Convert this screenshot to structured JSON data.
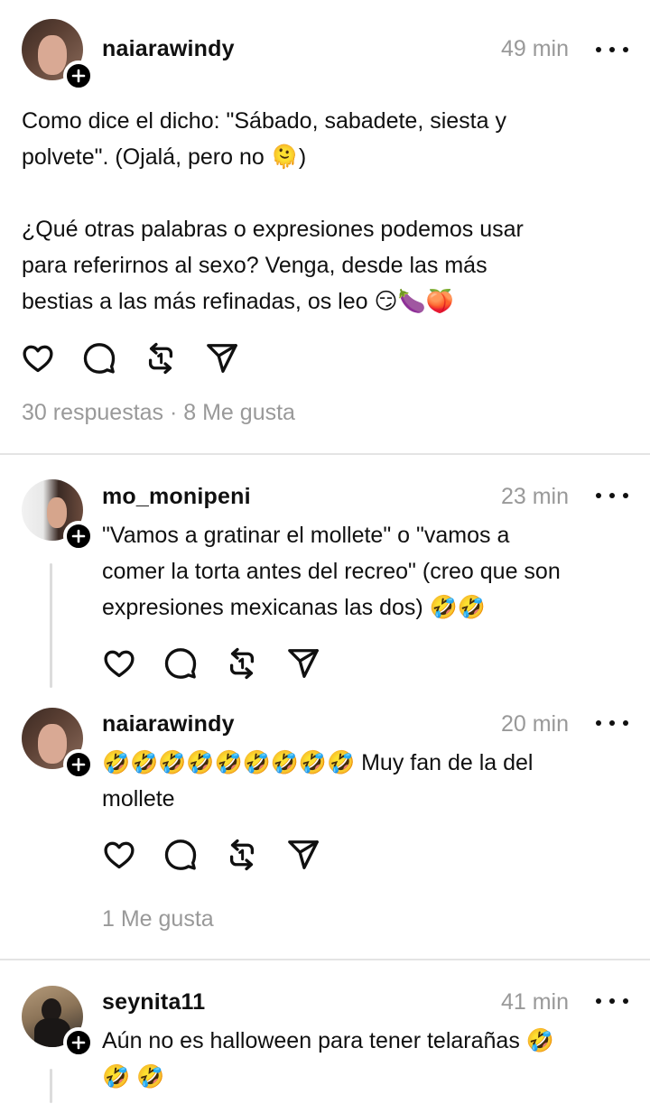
{
  "posts": [
    {
      "username": "naiarawindy",
      "time": "49 min",
      "text": "Como dice el dicho: \"Sábado, sabadete, siesta y\npolvete\". (Ojalá, pero no 🫠)\n\n¿Qué otras palabras o expresiones podemos usar\npara referirnos al sexo? Venga, desde las más\nbestias a las más refinadas, os leo 😏🍆🍑",
      "stats": "30 respuestas · 8 Me gusta"
    },
    {
      "username": "mo_monipeni",
      "time": "23 min",
      "text": "\"Vamos a gratinar el mollete\" o \"vamos a\ncomer la torta antes del recreo\" (creo que son\nexpresiones mexicanas las dos) 🤣🤣"
    },
    {
      "username": "naiarawindy",
      "time": "20 min",
      "text": "🤣🤣🤣🤣🤣🤣🤣🤣🤣 Muy fan de la del\nmollete",
      "stats": "1 Me gusta"
    },
    {
      "username": "seynita11",
      "time": "41 min",
      "text": "Aún no es halloween para tener telarañas 🤣\n🤣 🤣"
    }
  ],
  "icons": [
    "heart-icon",
    "comment-icon",
    "repost-icon",
    "share-icon",
    "more-icon",
    "follow-plus-icon"
  ],
  "colors": {
    "text": "#101010",
    "muted": "#999999",
    "divider": "#e4e4e4"
  }
}
